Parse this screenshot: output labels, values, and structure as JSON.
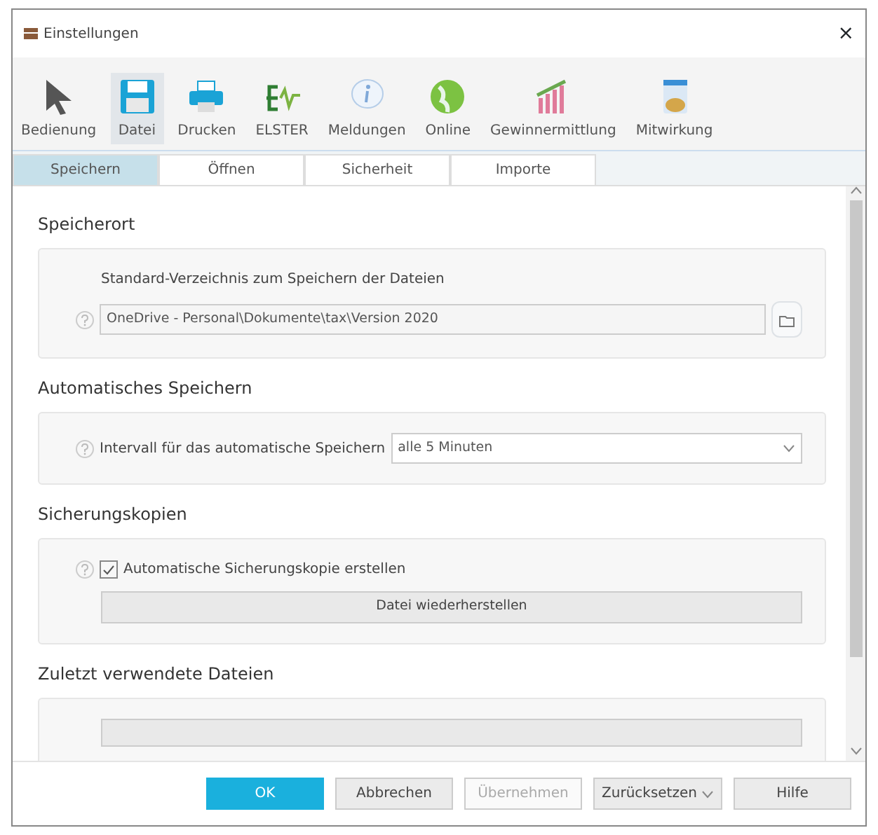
{
  "window": {
    "title": "Einstellungen",
    "close": "×"
  },
  "toolbar": [
    {
      "label": "Bedienung",
      "kind": "cursor",
      "selected": false
    },
    {
      "label": "Datei",
      "kind": "disk",
      "selected": true
    },
    {
      "label": "Drucken",
      "kind": "printer",
      "selected": false
    },
    {
      "label": "ELSTER",
      "kind": "elster",
      "selected": false
    },
    {
      "label": "Meldungen",
      "kind": "info",
      "selected": false
    },
    {
      "label": "Online",
      "kind": "globe",
      "selected": false
    },
    {
      "label": "Gewinnermittlung",
      "kind": "chart",
      "selected": false
    },
    {
      "label": "Mitwirkung",
      "kind": "doc",
      "selected": false
    }
  ],
  "tabs": [
    {
      "label": "Speichern",
      "selected": true
    },
    {
      "label": "Öffnen",
      "selected": false
    },
    {
      "label": "Sicherheit",
      "selected": false
    },
    {
      "label": "Importe",
      "selected": false
    }
  ],
  "sections": [
    {
      "title": "Speicherort",
      "items": [
        {
          "kind": "note",
          "text": "Standard-Verzeichnis zum Speichern der Dateien"
        },
        {
          "kind": "path",
          "value": "OneDrive - Personal\\Dokumente\\tax\\Version 2020"
        }
      ]
    },
    {
      "title": "Automatisches Speichern",
      "items": [
        {
          "kind": "select",
          "label": "Intervall für das automatische Speichern",
          "value": "alle 5 Minuten"
        }
      ]
    },
    {
      "title": "Sicherungskopien",
      "items": [
        {
          "kind": "checkbox",
          "label": "Automatische Sicherungskopie erstellen",
          "checked": true
        },
        {
          "kind": "button",
          "label": "Datei wiederherstellen"
        }
      ]
    },
    {
      "title": "Zuletzt verwendete Dateien",
      "items": [
        {
          "kind": "hidden-button"
        }
      ]
    }
  ],
  "buttons": [
    {
      "label": "OK",
      "kind": "primary",
      "disabled": false
    },
    {
      "label": "Abbrechen",
      "kind": "plain",
      "disabled": false
    },
    {
      "label": "Übernehmen",
      "kind": "plain",
      "disabled": true
    },
    {
      "label": "Zurücksetzen",
      "kind": "dropdown",
      "disabled": false
    },
    {
      "label": "Hilfe",
      "kind": "plain",
      "disabled": false
    }
  ]
}
